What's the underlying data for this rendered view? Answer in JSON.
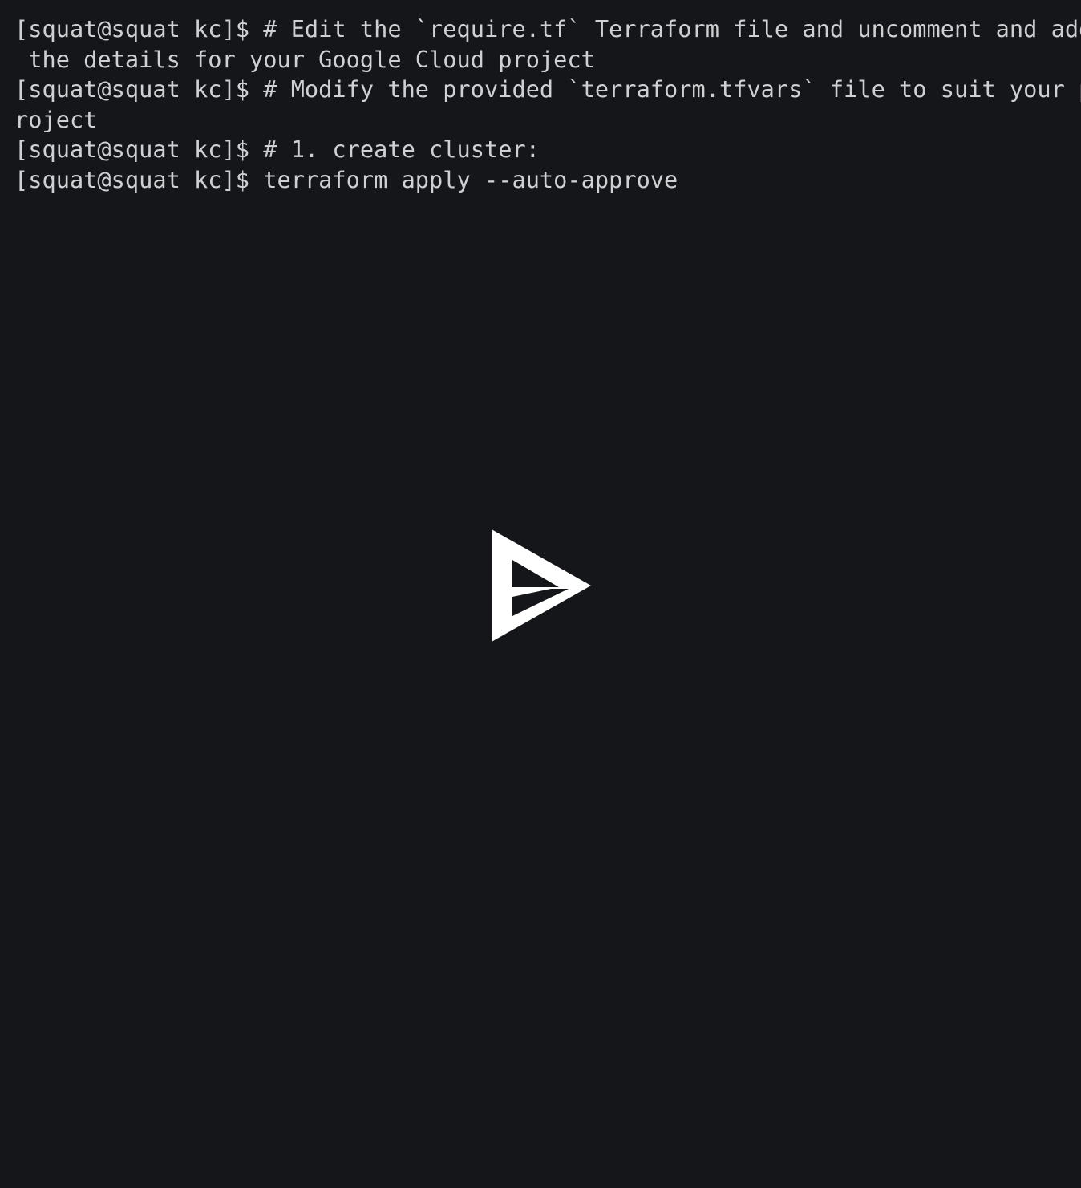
{
  "app": {
    "name": "asciinema-player",
    "background_color": "#151619",
    "foreground_color": "#cfd0d2",
    "logo_color": "#ffffff"
  },
  "terminal": {
    "prompt": "[squat@squat kc]$ ",
    "columns": 78,
    "lines": [
      "[squat@squat kc]$ # Edit the `require.tf` Terraform file and uncomment and add",
      " the details for your Google Cloud project",
      "[squat@squat kc]$ # Modify the provided `terraform.tfvars` file to suit your p",
      "roject",
      "[squat@squat kc]$ # 1. create cluster:",
      "[squat@squat kc]$ terraform apply --auto-approve",
      "",
      "",
      "",
      "",
      "",
      "",
      "",
      "",
      "",
      "",
      "",
      "",
      "",
      "",
      "",
      "",
      "",
      "",
      "",
      "",
      "",
      "",
      "",
      "",
      "",
      "",
      "",
      "",
      "",
      "",
      "",
      "",
      ""
    ]
  },
  "overlay": {
    "play_button_label": "Play",
    "icon": "asciinema-play-icon"
  }
}
